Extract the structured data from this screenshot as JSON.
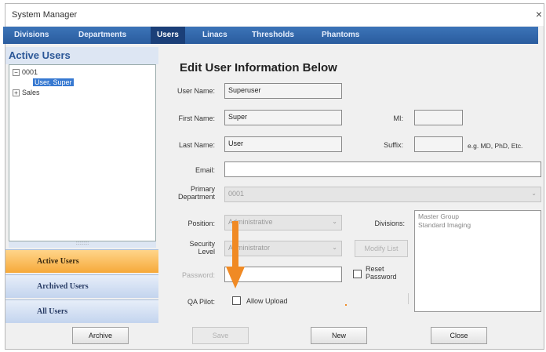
{
  "window": {
    "title": "System Manager",
    "close_glyph": "×"
  },
  "menu": {
    "tabs": [
      "Divisions",
      "Departments",
      "Users",
      "Linacs",
      "Thresholds",
      "Phantoms"
    ],
    "active": "Users"
  },
  "left": {
    "header": "Active Users",
    "tree": {
      "root": "0001",
      "child_selected": "User, Super",
      "sibling": "Sales",
      "expand_minus": "−",
      "expand_plus": "+"
    },
    "splitter_glyph": "::::::::::",
    "nav": [
      "Active Users",
      "Archived Users",
      "All Users"
    ],
    "archive_button": "Archive"
  },
  "form": {
    "heading": "Edit User Information Below",
    "username_label": "User Name:",
    "username_value": "Superuser",
    "firstname_label": "First Name:",
    "firstname_value": "Super",
    "mi_label": "MI:",
    "mi_value": "",
    "lastname_label": "Last Name:",
    "lastname_value": "User",
    "suffix_label": "Suffix:",
    "suffix_value": "",
    "suffix_hint": "e.g. MD, PhD, Etc.",
    "email_label": "Email:",
    "email_value": "",
    "primary_dept_label_1": "Primary",
    "primary_dept_label_2": "Department",
    "primary_dept_value": "0001",
    "position_label": "Position:",
    "position_value": "Administrative",
    "divisions_label": "Divisions:",
    "divisions": [
      "Master Group",
      "Standard Imaging"
    ],
    "security_label_1": "Security",
    "security_label_2": "Level",
    "security_value": "Administrator",
    "modify_button": "Modify List",
    "password_label": "Password:",
    "password_value": "",
    "reset_label_1": "Reset",
    "reset_label_2": "Password",
    "qa_label": "QA Pilot:",
    "allow_upload_label": "Allow Upload",
    "dropdown_glyph": "⌄"
  },
  "buttons": {
    "save": "Save",
    "new": "New",
    "close": "Close"
  },
  "colors": {
    "menubar": "#2a5c9e",
    "active_tab": "#1b3f78",
    "active_nav": "#f6a93a",
    "annotation_arrow": "#f08a24",
    "selection": "#3779d1"
  }
}
